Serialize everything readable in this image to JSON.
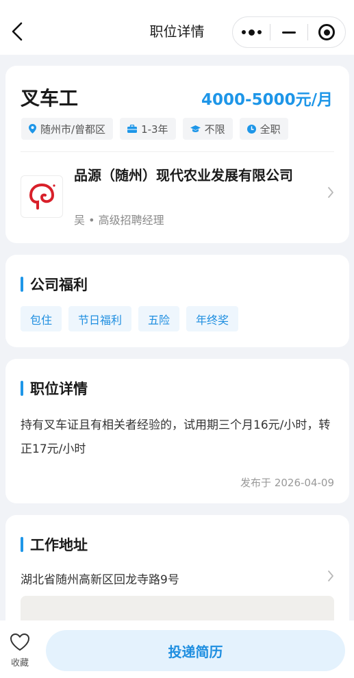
{
  "nav": {
    "title": "职位详情"
  },
  "job": {
    "title": "叉车工",
    "salary": "4000-5000元/月",
    "tags": [
      {
        "icon": "location-pin-icon",
        "label": "随州市/曾都区"
      },
      {
        "icon": "briefcase-icon",
        "label": "1-3年"
      },
      {
        "icon": "graduation-cap-icon",
        "label": "不限"
      },
      {
        "icon": "clock-icon",
        "label": "全职"
      }
    ]
  },
  "company": {
    "name": "品源（随州）现代农业发展有限公司",
    "recruiter": "吴 • 高级招聘经理",
    "logo_color": "#d8202a"
  },
  "benefits": {
    "title": "公司福利",
    "items": [
      "包住",
      "节日福利",
      "五险",
      "年终奖"
    ]
  },
  "details": {
    "title": "职位详情",
    "description": "持有叉车证且有相关者经验的，试用期三个月16元/小时，转正17元/小时",
    "published": "发布于 2026-04-09"
  },
  "address": {
    "title": "工作地址",
    "text": "湖北省随州高新区回龙寺路9号"
  },
  "bottom": {
    "favorite_label": "收藏",
    "apply_label": "投递简历"
  },
  "colors": {
    "accent": "#1e96e8",
    "background": "#f1f3f7"
  }
}
